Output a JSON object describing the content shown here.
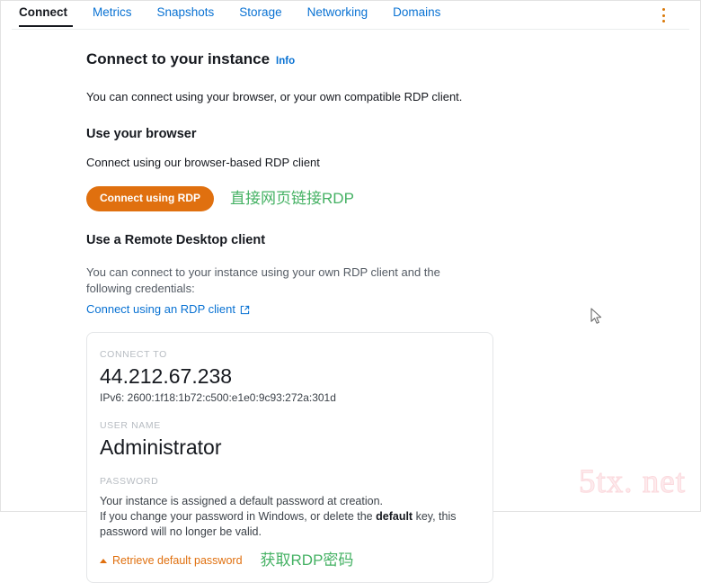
{
  "tabs": [
    {
      "label": "Connect",
      "active": true
    },
    {
      "label": "Metrics",
      "active": false
    },
    {
      "label": "Snapshots",
      "active": false
    },
    {
      "label": "Storage",
      "active": false
    },
    {
      "label": "Networking",
      "active": false
    },
    {
      "label": "Domains",
      "active": false
    }
  ],
  "overflow_menu_icon": "kebab-menu-icon",
  "main": {
    "page_title": "Connect to your instance",
    "info_label": "Info",
    "lead": "You can connect using your browser, or your own compatible RDP client.",
    "browser_section": {
      "heading": "Use your browser",
      "description": "Connect using our browser-based RDP client",
      "button_label": "Connect using RDP",
      "annotation": "直接网页链接RDP"
    },
    "client_section": {
      "heading": "Use a Remote Desktop client",
      "description": "You can connect to your instance using your own RDP client and the following credentials:",
      "link_label": "Connect using an RDP client",
      "link_icon": "external-link-icon"
    },
    "credentials": {
      "connect_to_label": "CONNECT TO",
      "connect_to_value": "44.212.67.238",
      "ipv6": "IPv6: 2600:1f18:1b72:c500:e1e0:9c93:272a:301d",
      "user_name_label": "USER NAME",
      "user_name_value": "Administrator",
      "password_label": "PASSWORD",
      "password_note_line1": "Your instance is assigned a default password at creation.",
      "password_note_line2_pre": "If you change your password in Windows, or delete the ",
      "password_note_bold": "default",
      "password_note_line2_post": " key, this password will no longer be valid.",
      "retrieve_label": "Retrieve default password",
      "retrieve_icon": "caret-up-icon",
      "retrieve_annotation": "获取RDP密码"
    }
  },
  "watermark": "5tx. net",
  "colors": {
    "accent_orange": "#e0700f",
    "link_blue": "#0972d3",
    "annotation_green": "#44b163",
    "text_dark": "#16191f"
  }
}
